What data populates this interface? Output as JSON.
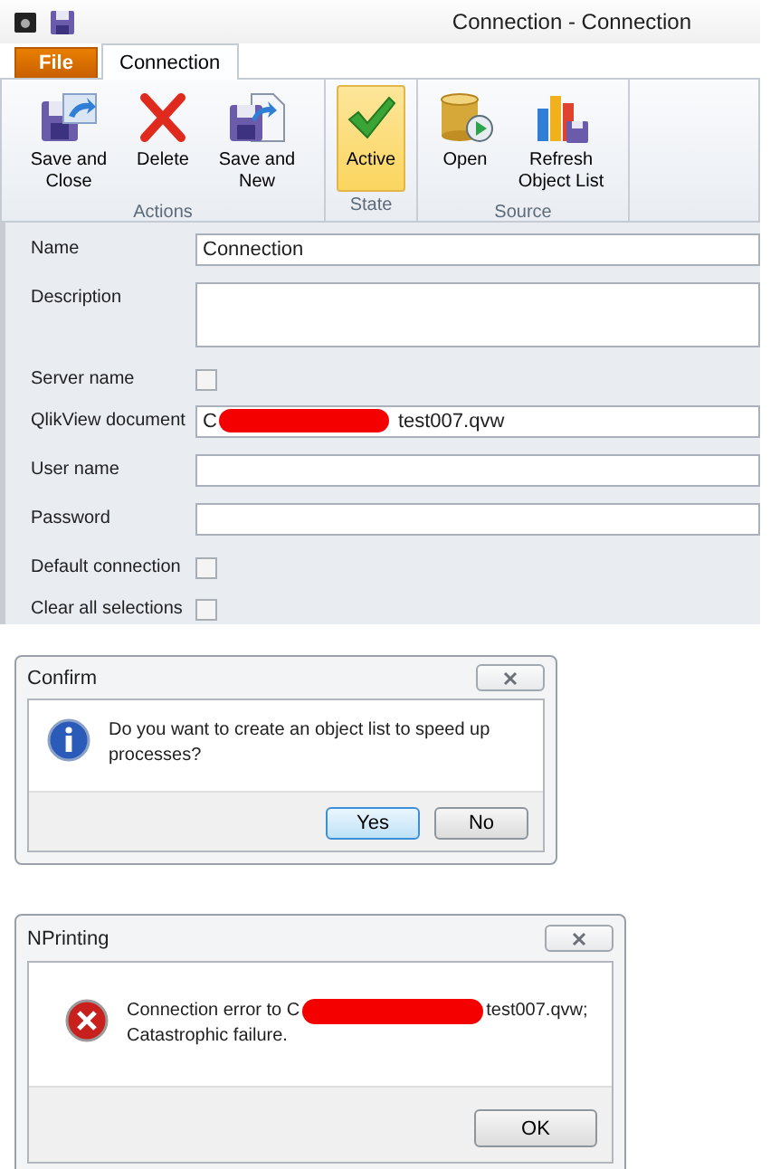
{
  "window": {
    "title": "Connection - Connection"
  },
  "tabs": [
    {
      "label": "File",
      "kind": "file",
      "selected": false
    },
    {
      "label": "Connection",
      "kind": "normal",
      "selected": true
    }
  ],
  "ribbon_groups": [
    {
      "label": "Actions",
      "buttons": [
        {
          "label": "Save and Close",
          "selected": false
        },
        {
          "label": "Delete",
          "selected": false
        },
        {
          "label": "Save and New",
          "selected": false
        }
      ]
    },
    {
      "label": "State",
      "buttons": [
        {
          "label": "Active",
          "selected": true
        }
      ]
    },
    {
      "label": "Source",
      "buttons": [
        {
          "label": "Open",
          "selected": false
        },
        {
          "label": "Refresh Object List",
          "selected": false
        }
      ]
    }
  ],
  "form": [
    {
      "label": "Name",
      "kind": "text",
      "value": "Connection"
    },
    {
      "label": "Description",
      "kind": "textarea"
    },
    {
      "label": "Server name",
      "kind": "checkbox",
      "checked": false
    },
    {
      "label": "QlikView document",
      "kind": "redacted",
      "value": [
        "C",
        "test007.qvw"
      ]
    },
    {
      "label": "User name",
      "kind": "text"
    },
    {
      "label": "Password",
      "kind": "text"
    },
    {
      "label": "Default connection",
      "kind": "checkbox",
      "checked": false
    },
    {
      "label": "Clear all selections",
      "kind": "checkbox",
      "checked": false
    }
  ],
  "dialogs": [
    {
      "title": "Confirm",
      "kind": "question",
      "message": [
        "Do you want to create an object list to speed up processes?"
      ],
      "buttons": [
        {
          "label": "Yes",
          "default": true
        },
        {
          "label": "No",
          "default": false
        }
      ]
    },
    {
      "title": "NPrinting",
      "kind": "error",
      "message": [
        "Connection error to C",
        "test007.qvw;"
      ],
      "message_line2": "Catastrophic failure.",
      "buttons": [
        {
          "label": "OK",
          "default": false
        }
      ]
    }
  ]
}
